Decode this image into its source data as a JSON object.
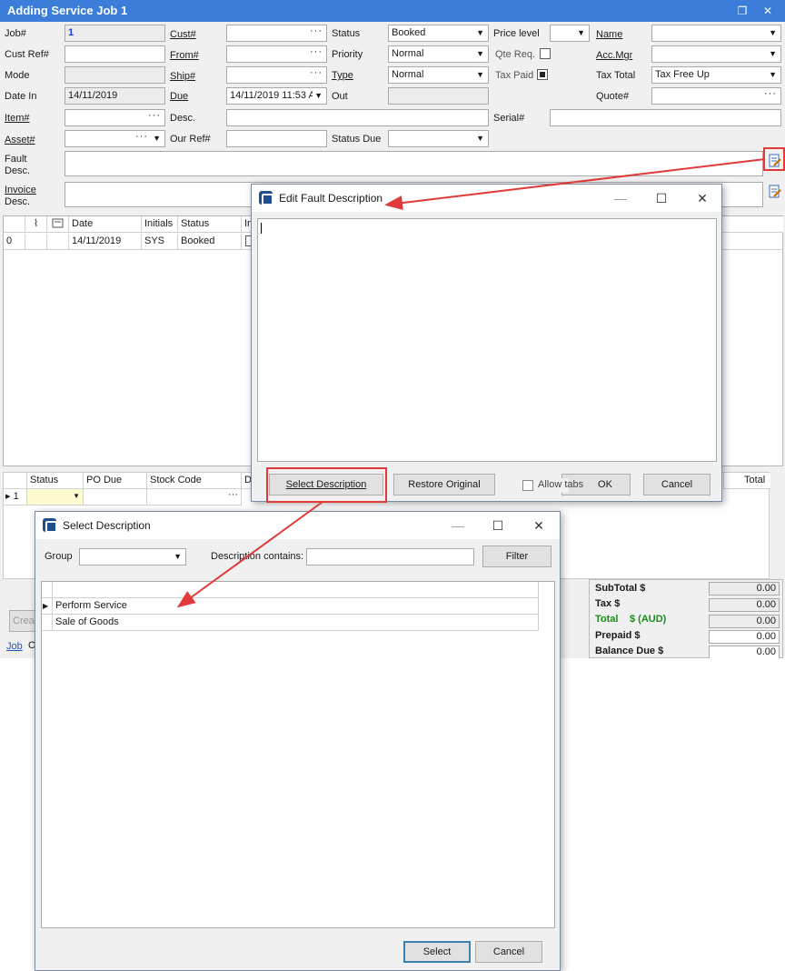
{
  "main": {
    "title": "Adding Service Job 1",
    "restore_icon": "❐",
    "close_icon": "✕",
    "labels": {
      "job": "Job#",
      "cust_ref": "Cust Ref#",
      "mode": "Mode",
      "date_in": "Date In",
      "item": "Item#",
      "asset": "Asset#",
      "fault": "Fault",
      "fault2": "Desc.",
      "invoice": "Invoice",
      "invoice2": "Desc.",
      "cust": "Cust#",
      "from": "From#",
      "ship": "Ship#",
      "due": "Due",
      "desc": "Desc.",
      "our_ref": "Our Ref#",
      "status": "Status",
      "priority": "Priority",
      "type": "Type",
      "out": "Out",
      "status_due": "Status Due",
      "price_level": "Price level",
      "qte_req": "Qte Req.",
      "tax_paid": "Tax Paid",
      "serial": "Serial#",
      "name": "Name",
      "acc_mgr": "Acc.Mgr",
      "tax_total": "Tax Total",
      "quote": "Quote#"
    },
    "values": {
      "job": "1",
      "date_in": "14/11/2019",
      "due": "14/11/2019 11:53 A",
      "status": "Booked",
      "priority": "Normal",
      "type": "Normal",
      "tax_total": "Tax Free Up"
    },
    "status_grid": {
      "headers": [
        "Date",
        "Initials",
        "Status",
        "In"
      ],
      "row": {
        "num": "0",
        "date": "14/11/2019",
        "initials": "SYS",
        "status": "Booked"
      }
    },
    "lines_grid": {
      "headers": [
        "Status",
        "PO Due",
        "Stock Code",
        "De",
        "Total"
      ],
      "row_num": "1"
    },
    "summary": {
      "subtotal_label": "SubTotal $",
      "tax_label": "Tax $",
      "total_label": "Total",
      "total_currency": "$ (AUD)",
      "prepaid_label": "Prepaid $",
      "balance_label": "Balance Due $",
      "subtotal": "0.00",
      "tax": "0.00",
      "total": "0.00",
      "prepaid": "0.00",
      "balance": "0.00"
    },
    "bottom": {
      "create_btn": "Crea",
      "tab_job": "Job",
      "tab_other": "O"
    }
  },
  "fault_dialog": {
    "title": "Edit Fault Description",
    "select_description": "Select Description",
    "restore_original": "Restore Original",
    "allow_tabs": "Allow tabs",
    "ok": "OK",
    "cancel": "Cancel"
  },
  "select_dialog": {
    "title": "Select Description",
    "group_label": "Group",
    "contains_label": "Description contains:",
    "filter": "Filter",
    "items": [
      "Perform Service",
      "Sale of Goods"
    ],
    "select": "Select",
    "cancel": "Cancel"
  },
  "window_controls": {
    "minimize": "—",
    "maximize": "☐",
    "close": "✕"
  },
  "colors": {
    "titlebar": "#3b7dd8",
    "highlight": "#e03a3a",
    "total_green": "#1a8a1a",
    "job_number": "#1c3fd0"
  }
}
